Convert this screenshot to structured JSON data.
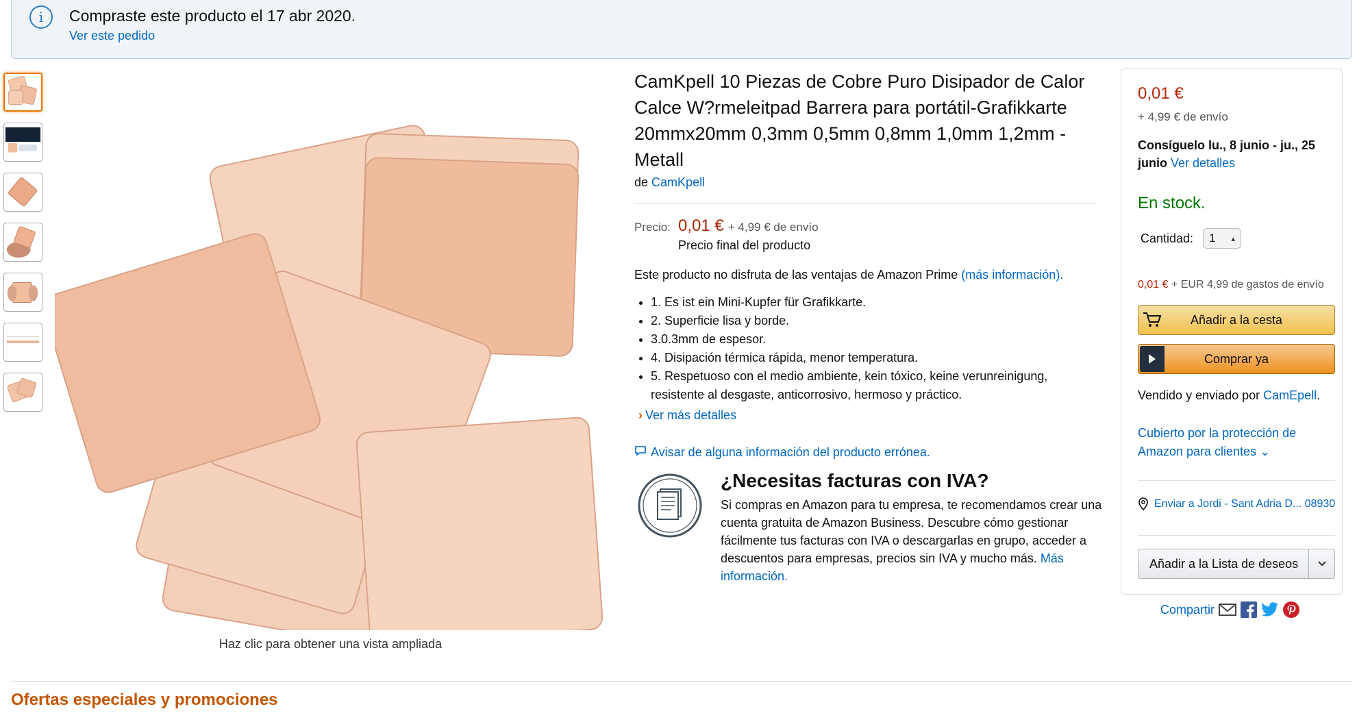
{
  "banner": {
    "icon": "info-icon",
    "title": "Compraste este producto el 17 abr 2020.",
    "link": "Ver este pedido"
  },
  "thumbnails": [
    {
      "icon": "copper-pads-thumb"
    },
    {
      "icon": "laptop-thumb"
    },
    {
      "icon": "single-pad-thumb"
    },
    {
      "icon": "hand-pad-thumb"
    },
    {
      "icon": "fingers-pad-thumb"
    },
    {
      "icon": "thickness-thumb"
    },
    {
      "icon": "pad-stack-thumb"
    }
  ],
  "image": {
    "caption": "Haz clic para obtener una vista ampliada"
  },
  "product": {
    "title": "CamKpell 10 Piezas de Cobre Puro Disipador de Calor Calce W?rmeleitpad Barrera para portátil-Grafikkarte 20mmx20mm 0,3mm 0,5mm 0,8mm 1,0mm 1,2mm - Metall",
    "by_prefix": "de",
    "brand": "CamKpell",
    "price_label": "Precio:",
    "price": "0,01 €",
    "shipping": "+ 4,99 € de envío",
    "final_price_note": "Precio final del producto",
    "prime_note": "Este producto no disfruta de las ventajas de Amazon Prime",
    "prime_link": "(más información).",
    "bullets": [
      "1. Es ist ein Mini-Kupfer für Grafikkarte.",
      "2. Superficie lisa y borde.",
      "3.0.3mm de espesor.",
      "4. Disipación térmica rápida, menor temperatura.",
      "5. Respetuoso con el medio ambiente, kein tóxico, keine verunreinigung, resistente al desgaste, anticorrosivo, hermoso y práctico."
    ],
    "more_details": "Ver más detalles",
    "report": "Avisar de alguna información del producto errónea."
  },
  "iva": {
    "title": "¿Necesitas facturas con IVA?",
    "text": "Si compras en Amazon para tu empresa, te recomendamos crear una cuenta gratuita de Amazon Business. Descubre cómo gestionar fácilmente tus facturas con IVA o descargarlas en grupo, acceder a descuentos para empresas, precios sin IVA y mucho más.",
    "link": "Más información."
  },
  "buybox": {
    "price": "0,01 €",
    "shipping": "+ 4,99 € de envío",
    "delivery": "Consíguelo lu., 8 junio - ju., 25 junio",
    "delivery_link": "Ver detalles",
    "stock": "En stock.",
    "qty_label": "Cantidad:",
    "qty_value": "1",
    "price2": "0,01 €",
    "price2_suffix": "+ EUR 4,99 de gastos de envío",
    "add_to_cart": "Añadir a la cesta",
    "buy_now": "Comprar ya",
    "sold_prefix": "Vendido y enviado por",
    "seller": "CamEpell",
    "protection": "Cubierto por la protección de Amazon para clientes",
    "address": "Enviar a Jordi - Sant Adria D... 08930",
    "wishlist": "Añadir a la Lista de deseos"
  },
  "share": {
    "label": "Compartir"
  },
  "offers": {
    "title": "Ofertas especiales y promociones"
  },
  "colors": {
    "price": "#b12704",
    "link": "#0066c0",
    "stock": "#007600",
    "offers": "#c45500",
    "copper": "#f0c2a6"
  }
}
